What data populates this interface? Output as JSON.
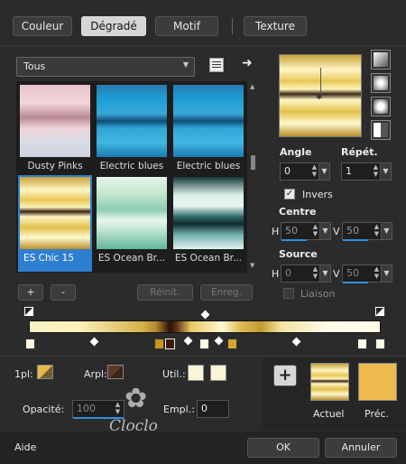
{
  "tabs": [
    {
      "label": "Couleur"
    },
    {
      "label": "Dégradé"
    },
    {
      "label": "Motif"
    },
    {
      "label": "Texture"
    }
  ],
  "category": {
    "selected": "Tous"
  },
  "gradients": [
    {
      "name": "Dusty Pinks"
    },
    {
      "name": "Electric blues"
    },
    {
      "name": "Electric blues"
    },
    {
      "name": "ES Chic 15"
    },
    {
      "name": "ES Ocean Br..."
    },
    {
      "name": "ES Ocean Br..."
    }
  ],
  "list_buttons": {
    "add": "+",
    "remove": "-",
    "reset": "Réinit.",
    "save": "Enreg."
  },
  "angle": {
    "label": "Angle",
    "value": "0"
  },
  "repeat": {
    "label": "Répét.",
    "value": "1"
  },
  "invert": {
    "label": "Invers",
    "checked": true
  },
  "centre": {
    "label": "Centre",
    "h_label": "H",
    "h_value": "50",
    "v_label": "V",
    "v_value": "50"
  },
  "source": {
    "label": "Source",
    "h_label": "H",
    "h_value": "0",
    "v_label": "V",
    "v_value": "50"
  },
  "link": {
    "label": "Liaison"
  },
  "bottom": {
    "first_plan_label": "1pl:",
    "background_label": "Arpl:",
    "user_label": "Util.:",
    "opacity_label": "Opacité:",
    "opacity_value": "100",
    "location_label": "Empl.:",
    "location_value": "0",
    "current_label": "Actuel",
    "previous_label": "Préc.",
    "plus": "+"
  },
  "footer": {
    "help": "Aide",
    "ok": "OK",
    "cancel": "Annuler"
  },
  "watermark": {
    "text": "Cloclo"
  },
  "colors": {
    "panel": "#2b2b2b",
    "accent": "#2f7fd0",
    "gold": "#e8b84a",
    "dark_brown": "#5a3a26"
  }
}
